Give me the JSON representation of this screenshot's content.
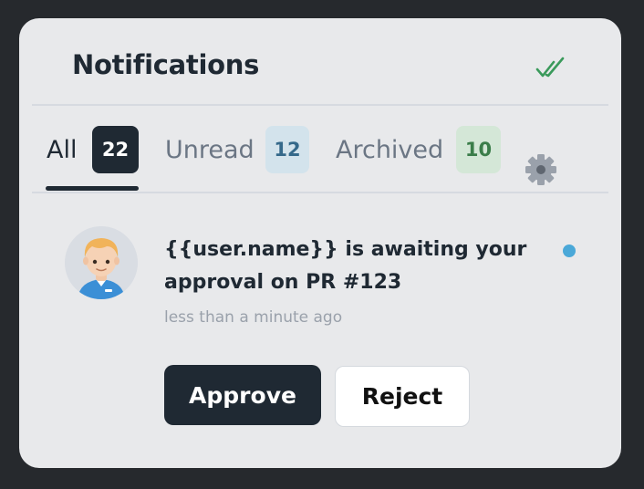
{
  "header": {
    "title": "Notifications",
    "mark_all_read_icon": "double-check-icon"
  },
  "tabs": [
    {
      "label": "All",
      "count": "22",
      "active": true
    },
    {
      "label": "Unread",
      "count": "12",
      "active": false
    },
    {
      "label": "Archived",
      "count": "10",
      "active": false
    }
  ],
  "settings_icon": "gear-icon",
  "notification": {
    "message": "{{user.name}} is awaiting your approval on PR #123",
    "timestamp": "less than a minute ago",
    "unread": true,
    "approve_label": "Approve",
    "reject_label": "Reject"
  },
  "colors": {
    "background": "#26292d",
    "panel": "#e8e9eb",
    "primary": "#1f2933",
    "unread_dot": "#4aa8d8",
    "check_green": "#3a9a5b"
  }
}
